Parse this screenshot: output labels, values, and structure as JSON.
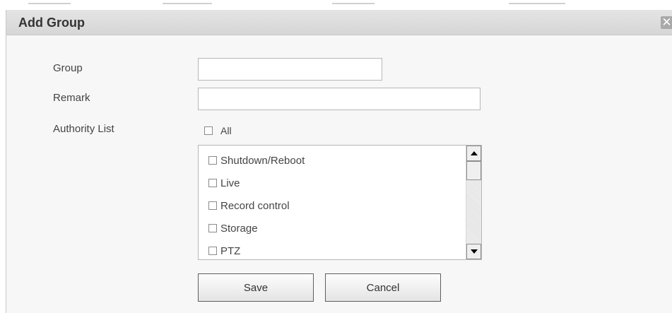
{
  "dialog": {
    "title": "Add Group",
    "close_symbol": "✕"
  },
  "form": {
    "group_label": "Group",
    "group_value": "",
    "remark_label": "Remark",
    "remark_value": "",
    "authority_label": "Authority List",
    "all_label": "All"
  },
  "authority_items": [
    {
      "label": "Shutdown/Reboot",
      "checked": false
    },
    {
      "label": "Live",
      "checked": false
    },
    {
      "label": "Record control",
      "checked": false
    },
    {
      "label": "Storage",
      "checked": false
    },
    {
      "label": "PTZ",
      "checked": false
    }
  ],
  "buttons": {
    "save_label": "Save",
    "cancel_label": "Cancel"
  },
  "icons": {
    "close": "close-icon",
    "scroll_up": "chevron-up-icon",
    "scroll_down": "chevron-down-icon"
  },
  "colors": {
    "titlebar": "#d6d6d6",
    "dialog_bg": "#f7f7f7",
    "close_button": "#a9a9a9"
  }
}
